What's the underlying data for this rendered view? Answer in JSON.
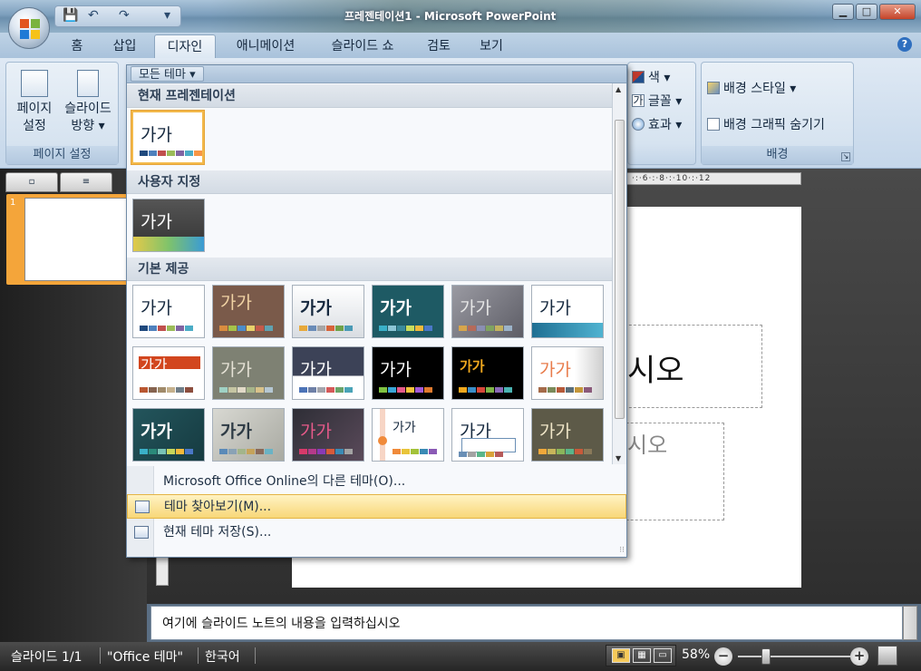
{
  "window": {
    "title": "프레젠테이션1 - Microsoft PowerPoint",
    "buttons": {
      "minimize": "▁",
      "maximize": "□",
      "close": "✕"
    }
  },
  "qat": {
    "save": "💾",
    "undo": "↶",
    "redo": "↷",
    "customize": "▾"
  },
  "tabs": [
    {
      "label": "홈"
    },
    {
      "label": "삽입"
    },
    {
      "label": "디자인",
      "active": true
    },
    {
      "label": "애니메이션"
    },
    {
      "label": "슬라이드 쇼"
    },
    {
      "label": "검토"
    },
    {
      "label": "보기"
    }
  ],
  "ribbon": {
    "page_setup": {
      "btn1_l1": "페이지",
      "btn1_l2": "설정",
      "btn2_l1": "슬라이드",
      "btn2_l2": "방향 ▾",
      "label": "페이지 설정"
    },
    "theme_opts": {
      "colors": "색 ▾",
      "fonts": "글꼴 ▾",
      "effects": "효과 ▾",
      "fonts_icon": "가"
    },
    "background": {
      "styles": "배경 스타일 ▾",
      "hide_graphics": "배경 그래픽 숨기기",
      "label": "배경"
    }
  },
  "ruler": {
    "text": "·:·6·:·8·:·10·:·12"
  },
  "slide": {
    "title_placeholder": "시오",
    "subtitle_placeholder": "시오"
  },
  "notes": {
    "placeholder": "여기에 슬라이드 노트의 내용을 입력하십시오"
  },
  "statusbar": {
    "slide": "슬라이드 1/1",
    "theme": "\"Office 테마\"",
    "lang": "한국어",
    "zoom": "58%"
  },
  "gallery": {
    "header_button": "모든 테마 ▾",
    "sections": {
      "current": "현재 프레젠테이션",
      "custom": "사용자 지정",
      "builtin": "기본 제공"
    },
    "thumb_text": "가가",
    "menu": {
      "online": "Microsoft Office Online의 다른 테마(O)...",
      "browse": "테마 찾아보기(M)...",
      "save": "현재 테마 저장(S)..."
    }
  },
  "colors": {
    "ribbon_bg": "#dfe9f4",
    "highlight": "#f8d778",
    "selected_thumb": "#f4a53a"
  }
}
